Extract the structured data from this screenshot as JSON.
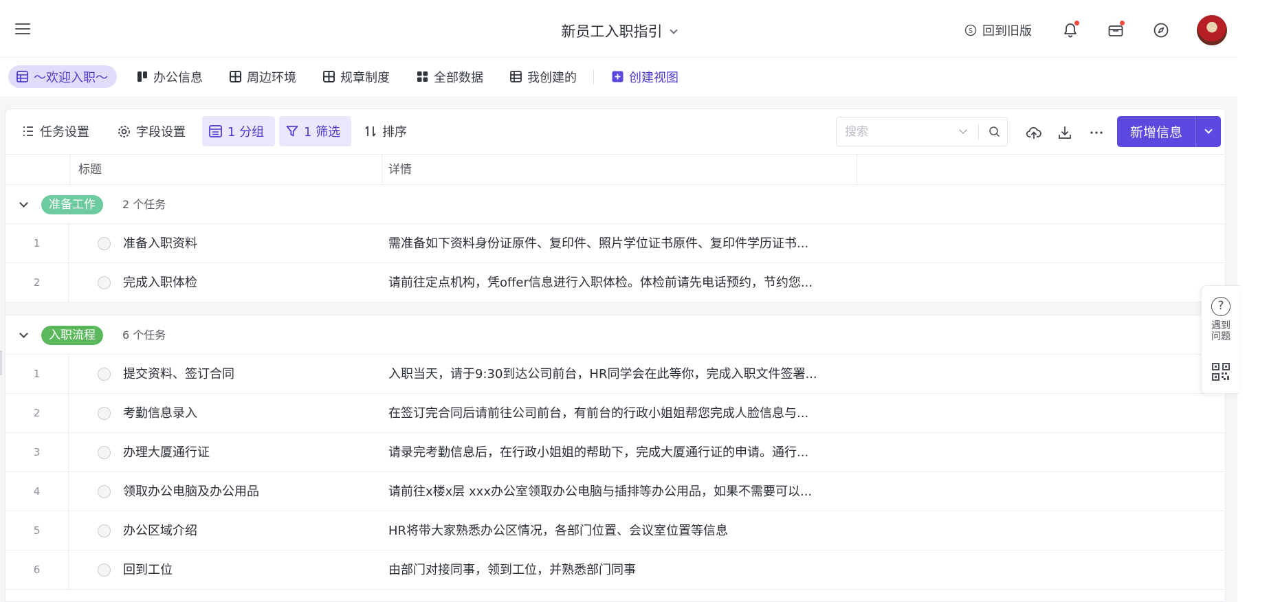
{
  "header": {
    "doc_title": "新员工入职指引",
    "old_version_label": "回到旧版"
  },
  "views": {
    "tabs": [
      {
        "label": "～欢迎入职～",
        "active": true
      },
      {
        "label": "办公信息"
      },
      {
        "label": "周边环境"
      },
      {
        "label": "规章制度"
      },
      {
        "label": "全部数据"
      },
      {
        "label": "我创建的"
      }
    ],
    "create_label": "创建视图"
  },
  "toolbar": {
    "task_settings": "任务设置",
    "field_settings": "字段设置",
    "group": "1 分组",
    "filter": "1 筛选",
    "sort": "排序",
    "search_placeholder": "搜索",
    "add_label": "新增信息"
  },
  "table": {
    "columns": [
      "标题",
      "详情"
    ],
    "groups": [
      {
        "tag": "准备工作",
        "tag_color": "#6ccb9f",
        "count": "2 个任务",
        "rows": [
          {
            "num": "1",
            "title": "准备入职资料",
            "detail": "需准备如下资料身份证原件、复印件、照片学位证书原件、复印件学历证书..."
          },
          {
            "num": "2",
            "title": "完成入职体检",
            "detail": "请前往定点机构，凭offer信息进行入职体检。体检前请先电话预约，节约您..."
          }
        ]
      },
      {
        "tag": "入职流程",
        "tag_color": "#5cb85c",
        "count": "6 个任务",
        "rows": [
          {
            "num": "1",
            "title": "提交资料、签订合同",
            "detail": "入职当天，请于9:30到达公司前台，HR同学会在此等你，完成入职文件签署..."
          },
          {
            "num": "2",
            "title": "考勤信息录入",
            "detail": "在签订完合同后请前往公司前台，有前台的行政小姐姐帮您完成人脸信息与..."
          },
          {
            "num": "3",
            "title": "办理大厦通行证",
            "detail": "请录完考勤信息后，在行政小姐姐的帮助下，完成大厦通行证的申请。通行..."
          },
          {
            "num": "4",
            "title": "领取办公电脑及办公用品",
            "detail": "请前往x楼x层 xxx办公室领取办公电脑与插排等办公用品，如果不需要可以..."
          },
          {
            "num": "5",
            "title": "办公区域介绍",
            "detail": "HR将带大家熟悉办公区情况，各部门位置、会议室位置等信息"
          },
          {
            "num": "6",
            "title": "回到工位",
            "detail": "由部门对接同事，领到工位，并熟悉部门同事"
          }
        ]
      }
    ]
  },
  "help": {
    "text_line1": "遇到",
    "text_line2": "问题"
  },
  "colors": {
    "accent": "#5b49e0",
    "active_tab_bg": "#e2dcfb",
    "notification_dot": "#f04a3f"
  },
  "icons": [
    "menu-icon",
    "chevron-down-icon",
    "old-version-icon",
    "bell-icon",
    "inbox-icon",
    "compass-icon",
    "table-icon",
    "kanban-icon",
    "grid-icon",
    "list-icon",
    "plus-icon",
    "filter-icon",
    "sort-icon",
    "gear-icon",
    "upload-icon",
    "download-icon",
    "more-icon",
    "search-icon",
    "help-icon",
    "qrcode-icon"
  ]
}
